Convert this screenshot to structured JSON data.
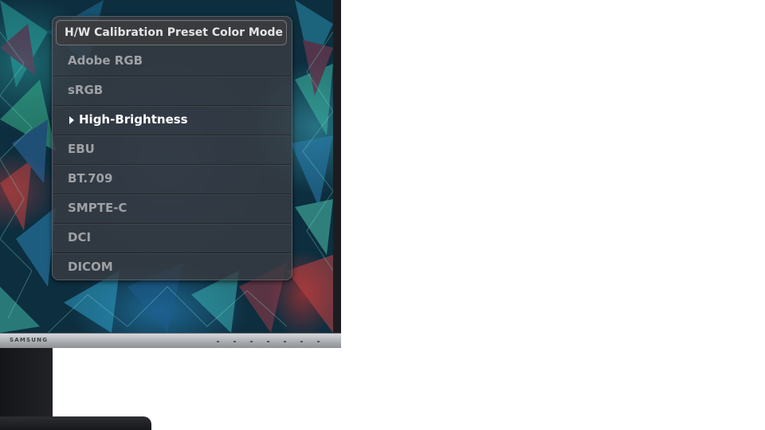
{
  "monitor": {
    "brand": "SAMSUNG"
  },
  "osd": {
    "title": "H/W Calibration Preset Color Mode",
    "selected_index": 2,
    "selection_icon": "triangle-right-icon",
    "items": [
      {
        "label": "Adobe RGB"
      },
      {
        "label": "sRGB"
      },
      {
        "label": "High-Brightness"
      },
      {
        "label": "EBU"
      },
      {
        "label": "BT.709"
      },
      {
        "label": "SMPTE-C"
      },
      {
        "label": "DCI"
      },
      {
        "label": "DICOM"
      }
    ]
  },
  "colors": {
    "menu_background": "#3a3c42",
    "item_text": "#9fa1a5",
    "selected_text": "#ffffff",
    "title_text": "#e4e4e4"
  }
}
